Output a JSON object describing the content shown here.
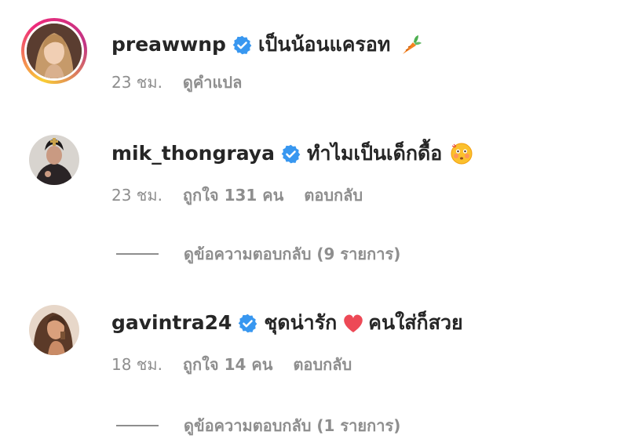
{
  "comments": [
    {
      "username": "preawwnp",
      "text": "เป็นน้อนแครอท",
      "emoji": "carrot",
      "time": "23 ชม.",
      "translate_label": "ดูคำแปล"
    },
    {
      "username": "mik_thongraya",
      "text": "ทำไมเป็นเด็กดื้อ",
      "emoji": "flushed-face",
      "time": "23 ชม.",
      "likes": "ถูกใจ 131 คน",
      "reply_label": "ตอบกลับ",
      "view_replies": "ดูข้อความตอบกลับ (9 รายการ)"
    },
    {
      "username": "gavintra24",
      "text_before": "ชุดน่ารัก",
      "emoji": "red-heart",
      "text_after": "คนใส่ก็สวย",
      "time": "18 ชม.",
      "likes": "ถูกใจ 14 คน",
      "reply_label": "ตอบกลับ",
      "view_replies": "ดูข้อความตอบกลับ (1 รายการ)"
    }
  ],
  "colors": {
    "verified": "#3897f0",
    "text": "#262626",
    "secondary": "#8e8e8e",
    "heart": "#ed4956"
  }
}
